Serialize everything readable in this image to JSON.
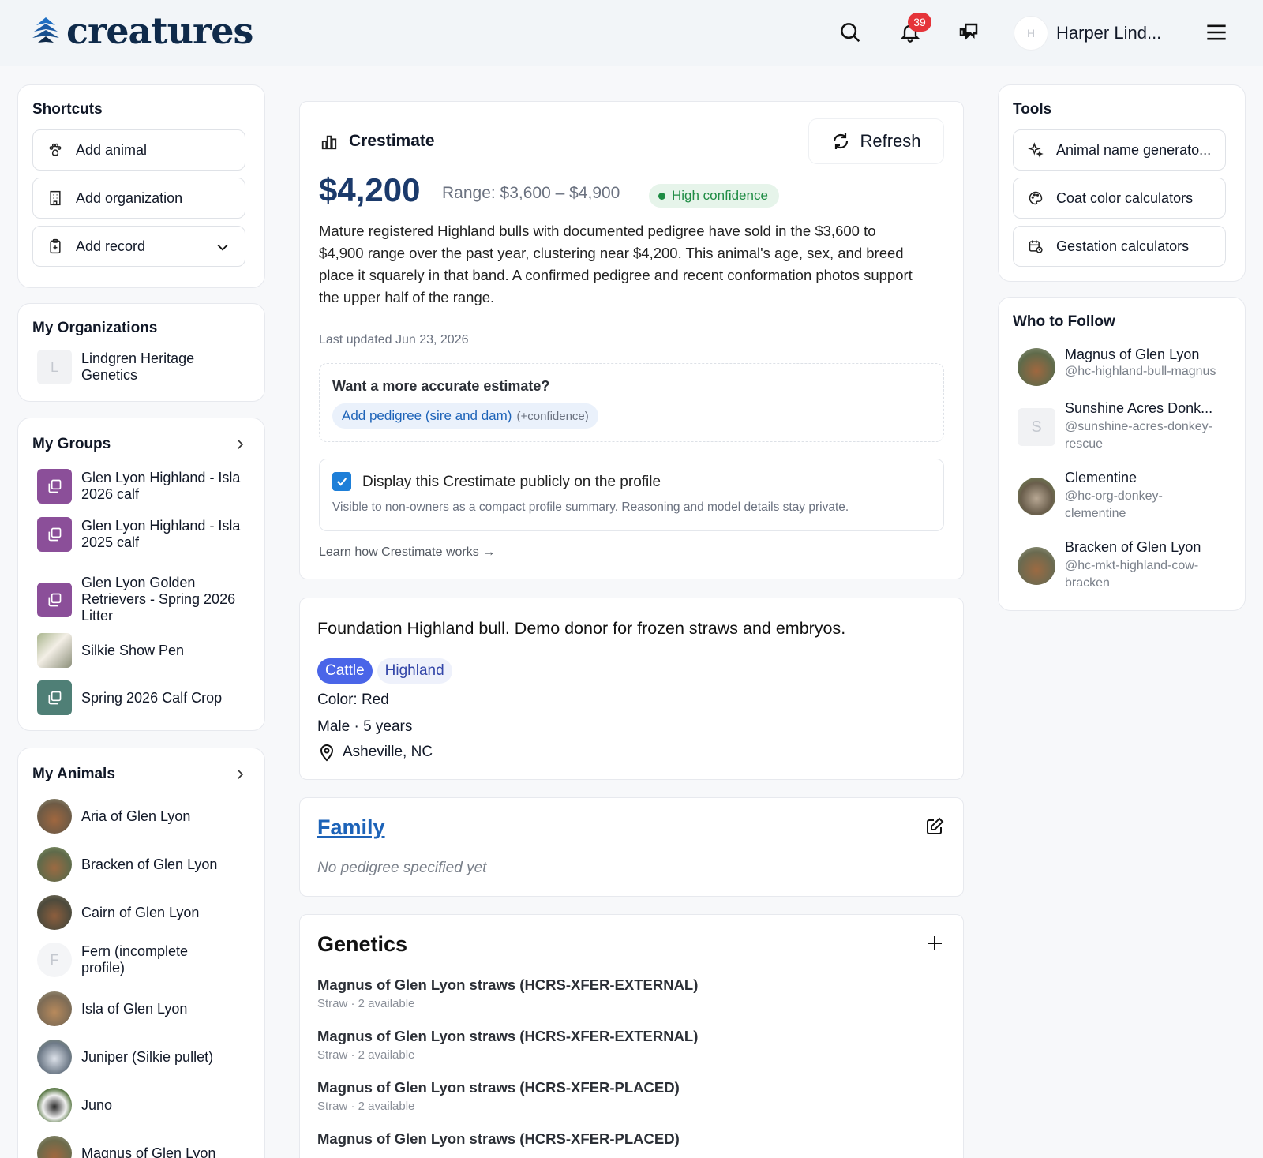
{
  "header": {
    "logo_text": "creatures",
    "notification_count": "39",
    "user_initial": "H",
    "user_name": "Harper Lind..."
  },
  "shortcuts": {
    "title": "Shortcuts",
    "items": [
      {
        "label": "Add animal",
        "icon": "paw-icon"
      },
      {
        "label": "Add organization",
        "icon": "building-icon"
      },
      {
        "label": "Add record",
        "icon": "clipboard-icon"
      }
    ]
  },
  "organizations": {
    "title": "My Organizations",
    "items": [
      {
        "initial": "L",
        "name": "Lindgren Heritage Genetics"
      }
    ]
  },
  "groups": {
    "title": "My Groups",
    "items": [
      "Glen Lyon Highland - Isla 2026 calf",
      "Glen Lyon Highland - Isla 2025 calf",
      "Glen Lyon Golden Retrievers - Spring 2026 Litter",
      "Silkie Show Pen",
      "Spring 2026 Calf Crop"
    ]
  },
  "animals": {
    "title": "My Animals",
    "items": [
      {
        "name": "Aria of Glen Lyon",
        "initial": ""
      },
      {
        "name": "Bracken of Glen Lyon",
        "initial": ""
      },
      {
        "name": "Cairn of Glen Lyon",
        "initial": ""
      },
      {
        "name": "Fern (incomplete profile)",
        "initial": "F"
      },
      {
        "name": "Isla of Glen Lyon",
        "initial": ""
      },
      {
        "name": "Juniper (Silkie pullet)",
        "initial": ""
      },
      {
        "name": "Juno",
        "initial": ""
      },
      {
        "name": "Magnus of Glen Lyon",
        "initial": ""
      }
    ]
  },
  "crestimate": {
    "title": "Crestimate",
    "refresh_label": "Refresh",
    "price": "$4,200",
    "range": "Range: $3,600 – $4,900",
    "confidence": "High confidence",
    "reasoning": "Mature registered Highland bulls with documented pedigree have sold in the $3,600 to $4,900 range over the past year, clustering near $4,200. This animal's age, sex, and breed place it squarely in that band. A confirmed pedigree and recent conformation photos support the upper half of the range.",
    "updated": "Last updated Jun 23, 2026",
    "improve_title": "Want a more accurate estimate?",
    "improve_action": "Add pedigree (sire and dam)",
    "improve_hint": "(+confidence)",
    "public_label": "Display this Crestimate publicly on the profile",
    "public_hint": "Visible to non-owners as a compact profile summary. Reasoning and model details stay private.",
    "learn_link": "Learn how Crestimate works →"
  },
  "profile": {
    "description": "Foundation Highland bull. Demo donor for frozen straws and embryos.",
    "species_tag": "Cattle",
    "breed_tag": "Highland",
    "color": "Color: Red",
    "sex_age": "Male · 5 years",
    "location": "Asheville, NC"
  },
  "family": {
    "title": "Family",
    "empty": "No pedigree specified yet"
  },
  "genetics": {
    "title": "Genetics",
    "items": [
      {
        "title": "Magnus of Glen Lyon straws (HCRS-XFER-EXTERNAL)",
        "sub": "Straw · 2 available"
      },
      {
        "title": "Magnus of Glen Lyon straws (HCRS-XFER-EXTERNAL)",
        "sub": "Straw · 2 available"
      },
      {
        "title": "Magnus of Glen Lyon straws (HCRS-XFER-PLACED)",
        "sub": "Straw · 2 available"
      },
      {
        "title": "Magnus of Glen Lyon straws (HCRS-XFER-PLACED)",
        "sub": ""
      }
    ]
  },
  "tools": {
    "title": "Tools",
    "items": [
      {
        "label": "Animal name generato...",
        "icon": "sparkle-icon"
      },
      {
        "label": "Coat color calculators",
        "icon": "palette-icon"
      },
      {
        "label": "Gestation calculators",
        "icon": "calendar-clock-icon"
      }
    ]
  },
  "follow": {
    "title": "Who to Follow",
    "items": [
      {
        "name": "Magnus of Glen Lyon",
        "handle": "@hc-highland-bull-magnus",
        "initial": ""
      },
      {
        "name": "Sunshine Acres Donk...",
        "handle": "@sunshine-acres-donkey-rescue",
        "initial": "S"
      },
      {
        "name": "Clementine",
        "handle": "@hc-org-donkey-clementine",
        "initial": ""
      },
      {
        "name": "Bracken of Glen Lyon",
        "handle": "@hc-mkt-highland-cow-bracken",
        "initial": ""
      }
    ]
  },
  "colors": {
    "brand": "#0f2a4a",
    "price": "#1b3a6b",
    "confidence": "#1e8c44",
    "link": "#1d63b8",
    "tag": "#4a65e8",
    "badge": "#e5343a"
  }
}
